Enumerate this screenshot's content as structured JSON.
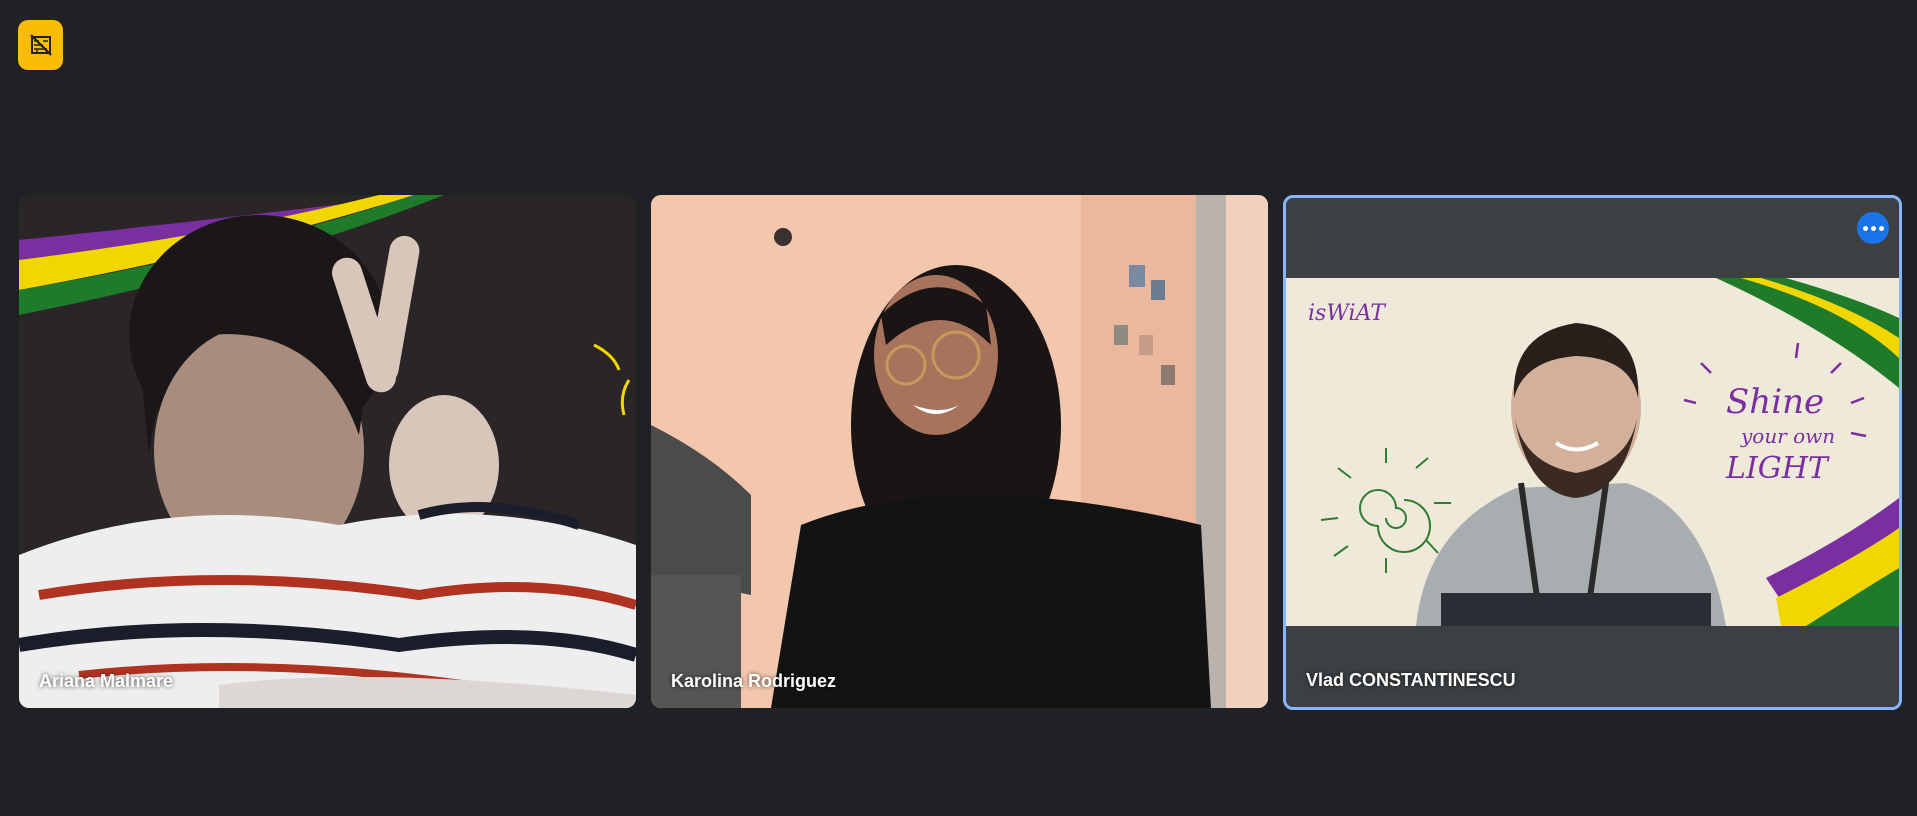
{
  "toolbar": {
    "visual_effects_icon": "no-background-icon",
    "accent_color": "#fbbc04"
  },
  "participants": [
    {
      "name": "Ariana Malmare",
      "background": "dark-with-colored-stripes"
    },
    {
      "name": "Karolina Rodriguez",
      "background": "peach-room"
    },
    {
      "name": "Vlad CONSTANTINESCU",
      "background": "cream-with-doodles",
      "active_speaker": true,
      "badge": "isWiAT",
      "doodle_text": [
        "Shine",
        "your own",
        "LIGHT"
      ]
    }
  ],
  "colors": {
    "page_bg": "#202124",
    "tile_bg": "#3c4043",
    "active_border": "#8ab4f8",
    "more_button": "#1a73e8"
  }
}
